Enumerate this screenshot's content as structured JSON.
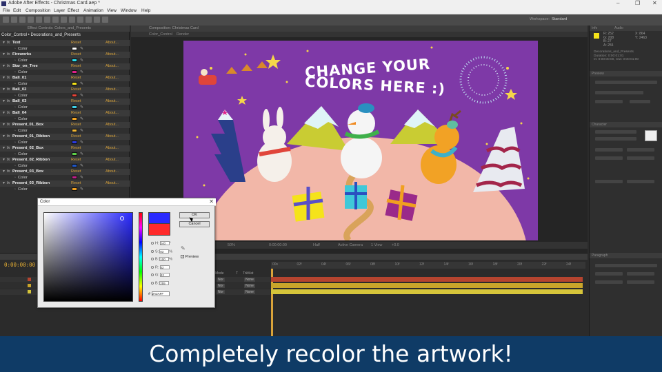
{
  "app": {
    "window_title": "Adobe After Effects - Christmas Card.aep *",
    "window_controls": [
      "–",
      "❐",
      "✕"
    ]
  },
  "menu": [
    "File",
    "Edit",
    "Composition",
    "Layer",
    "Effect",
    "Animation",
    "View",
    "Window",
    "Help"
  ],
  "toolbar": {
    "workspace_label": "Workspace:",
    "workspace_value": "Standard"
  },
  "effect_controls": {
    "tab_label": "Effect Controls: Colors_and_Presents",
    "header": "Color_Control • Decorations_and_Presents",
    "reset_label": "Reset",
    "about_label": "About...",
    "color_label": "Color",
    "effects": [
      {
        "name": "Text",
        "color": "#ffffff"
      },
      {
        "name": "Fireworks",
        "color": "#29e0f0"
      },
      {
        "name": "Star_on_Tree",
        "color": "#e0208a"
      },
      {
        "name": "Ball_01",
        "color": "#f5e31a"
      },
      {
        "name": "Ball_02",
        "color": "#e6453a"
      },
      {
        "name": "Ball_03",
        "color": "#3fd0e8"
      },
      {
        "name": "Ball_04",
        "color": "#f5a623"
      },
      {
        "name": "Present_01_Box",
        "color": "#f2b632"
      },
      {
        "name": "Present_01_Ribbon",
        "color": "#2a3ae0"
      },
      {
        "name": "Present_02_Box",
        "color": "#5fd04a"
      },
      {
        "name": "Present_02_Ribbon",
        "color": "#1f56c8"
      },
      {
        "name": "Present_03_Box",
        "color": "#c0208a"
      },
      {
        "name": "Present_03_Ribbon",
        "color": "#f0a020"
      }
    ]
  },
  "composition": {
    "tab_label": "Composition: Christmas Card",
    "sub_tabs": [
      "Color_Control",
      "Render"
    ],
    "headline_line1": "CHANGE YOUR",
    "headline_line2": "COLORS HERE :)",
    "zoom": "50%",
    "timecode": "0:00:00:00",
    "resolution": "Half",
    "view": "Active Camera",
    "views": "1 View",
    "exposure": "+0.0"
  },
  "timeline": {
    "timecode": "0:00:00:00",
    "columns": [
      "Mode",
      "T",
      "TrkMat"
    ],
    "ruler_ticks": [
      "00s",
      "02f",
      "04f",
      "06f",
      "08f",
      "10f",
      "12f",
      "14f",
      "16f",
      "18f",
      "20f",
      "22f",
      "24f"
    ],
    "layers": [
      {
        "mode": "Nor",
        "trkmat": "None",
        "bar_color": "#b5442f"
      },
      {
        "mode": "Nor",
        "trkmat": "None",
        "bar_color": "#c9a52a"
      },
      {
        "mode": "Nor",
        "trkmat": "None",
        "bar_color": "#d6c53a"
      }
    ]
  },
  "right_panels": {
    "info_tab": "Info",
    "audio_tab": "Audio",
    "preview_tab": "Preview",
    "character_tab": "Character",
    "paragraph_tab": "Paragraph",
    "info_lines": [
      "R: 252",
      "G: 208",
      "B: 27",
      "A: 255",
      "X: 864",
      "Y: 2463"
    ],
    "info_text": [
      "Decorations_and_Presents",
      "Duration: 0:00:01:01",
      "In: 0:00:00:00, Out: 0:00:01:00"
    ]
  },
  "color_dialog": {
    "title": "Color",
    "ok_label": "OK",
    "cancel_label": "Cancel",
    "preview_label": "Preview",
    "new_color": "#2a2aff",
    "old_color": "#ff2a2a",
    "fields": [
      {
        "label": "H:",
        "value": "240",
        "unit": "°"
      },
      {
        "label": "S:",
        "value": "83",
        "unit": "%"
      },
      {
        "label": "B:",
        "value": "100",
        "unit": "%"
      },
      {
        "label": "R:",
        "value": "42",
        "unit": ""
      },
      {
        "label": "G:",
        "value": "42",
        "unit": ""
      },
      {
        "label": "B:",
        "value": "255",
        "unit": ""
      }
    ],
    "hex_label": "#",
    "hex_value": "2A2AFF"
  },
  "caption": "Completely recolor the artwork!"
}
